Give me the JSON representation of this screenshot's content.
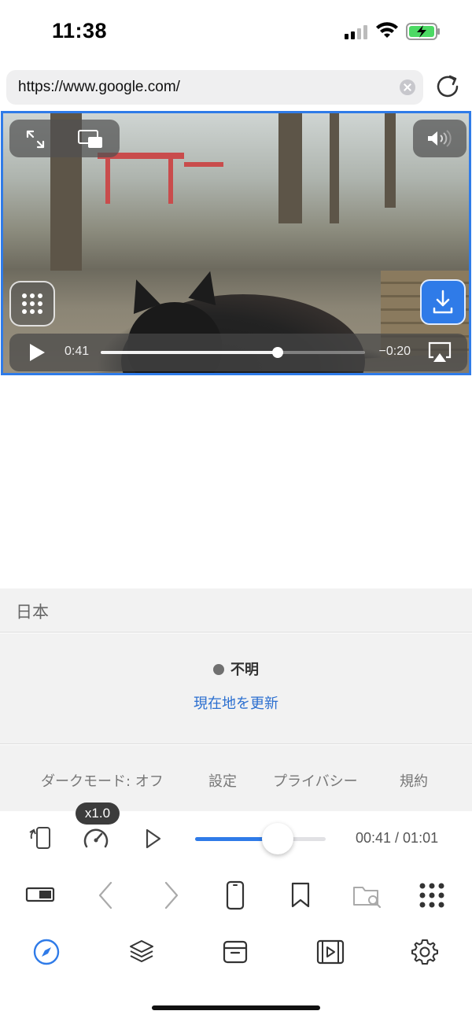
{
  "status_bar": {
    "time": "11:38"
  },
  "browser": {
    "url": "https://www.google.com/"
  },
  "video": {
    "elapsed": "0:41",
    "remaining": "−0:20",
    "progress": 0.67
  },
  "info": {
    "region": "日本",
    "location_status": "不明",
    "update_location": "現在地を更新",
    "footer_links": [
      "ダークモード: オフ",
      "設定",
      "プライバシー",
      "規約"
    ]
  },
  "player": {
    "speed": "x1.0",
    "progress": 0.63,
    "time": "00:41 / 01:01"
  },
  "colors": {
    "accent": "#2f7be8",
    "link": "#2b6fd0"
  },
  "icons": {
    "player_row": [
      "rotate-icon",
      "speed-gauge-icon",
      "play-icon"
    ],
    "toolbar": [
      "toggle-icon",
      "back-icon",
      "forward-icon",
      "phone-icon",
      "bookmark-icon",
      "folder-search-icon",
      "grid-icon"
    ],
    "tabbar": [
      "compass-icon",
      "layers-icon",
      "archive-icon",
      "video-icon",
      "settings-icon"
    ]
  }
}
